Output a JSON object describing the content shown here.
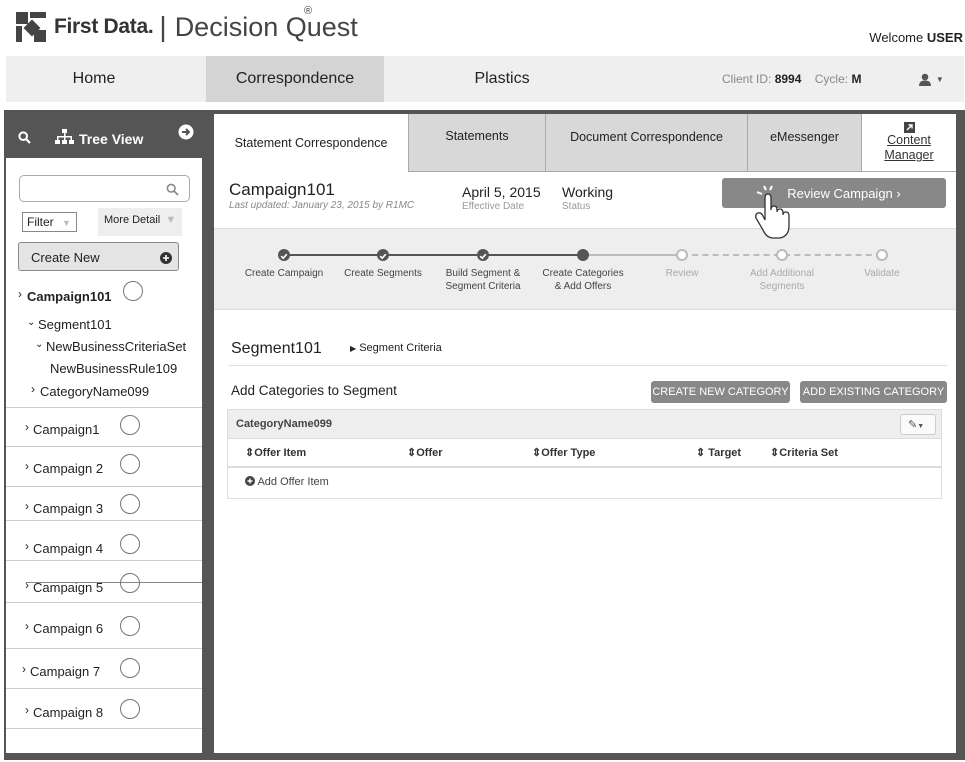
{
  "header": {
    "brand": "First Data.",
    "product": "Decision Quest",
    "welcome_prefix": "Welcome",
    "user": "USER"
  },
  "topnav": {
    "tabs": [
      "Home",
      "Correspondence",
      "Plastics"
    ],
    "active": "Correspondence",
    "client_label": "Client ID:",
    "client_id": "8994",
    "cycle_label": "Cycle:",
    "cycle": "M"
  },
  "sidebar": {
    "tree_view_label": "Tree View",
    "filter_label": "Filter",
    "more_detail_label": "More Detail",
    "create_new_label": "Create New",
    "tree": {
      "campaign": "Campaign101",
      "segment": "Segment101",
      "criteria_set": "NewBusinessCriteriaSet",
      "rule": "NewBusinessRule109",
      "category": "CategoryName099"
    },
    "campaigns": [
      "Campaign1",
      "Campaign 2",
      "Campaign 3",
      "Campaign 4",
      "Campaign 5",
      "Campaign 6",
      "Campaign 7",
      "Campaign 8"
    ]
  },
  "subtabs": {
    "statement_correspondence": "Statement Correspondence",
    "statements": "Statements",
    "document_correspondence": "Document Correspondence",
    "emessenger": "eMessenger",
    "content_manager_line1": "Content",
    "content_manager_line2": "Manager"
  },
  "campaign_info": {
    "name": "Campaign101",
    "last_updated": "Last updated: January 23, 2015 by R1MC",
    "date": "April 5, 2015",
    "date_label": "Effective Date",
    "status": "Working",
    "status_label": "Status",
    "review_button": "Review Campaign ›"
  },
  "steps": [
    {
      "line1": "Create Campaign",
      "line2": "",
      "state": "done"
    },
    {
      "line1": "Create Segments",
      "line2": "",
      "state": "done"
    },
    {
      "line1": "Build Segment &",
      "line2": "Segment Criteria",
      "state": "done"
    },
    {
      "line1": "Create Categories",
      "line2": "& Add Offers",
      "state": "current"
    },
    {
      "line1": "Review",
      "line2": "",
      "state": "todo"
    },
    {
      "line1": "Add Additional",
      "line2": "Segments",
      "state": "todo"
    },
    {
      "line1": "Validate",
      "line2": "",
      "state": "todo"
    }
  ],
  "segment": {
    "name": "Segment101",
    "criteria_link": "Segment Criteria",
    "add_categories_label": "Add Categories to Segment",
    "create_category_button": "CREATE NEW CATEGORY",
    "add_existing_button": "ADD EXISTING CATEGORY",
    "category_name": "CategoryName099",
    "columns": [
      "Offer Item",
      "Offer",
      "Offer Type",
      "Target",
      "Criteria Set"
    ],
    "add_offer_item": "Add Offer Item"
  },
  "colors": {
    "frame": "#555555",
    "button_grey": "#888888",
    "active_tab": "#d4d4d4"
  }
}
